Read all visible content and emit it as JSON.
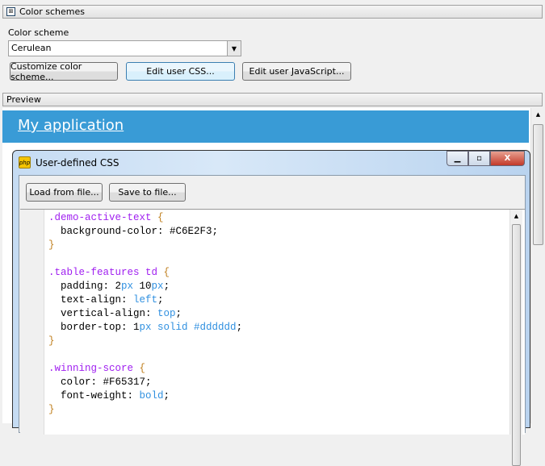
{
  "panel": {
    "title": "Color schemes",
    "scheme_label": "Color scheme",
    "scheme_value": "Cerulean",
    "buttons": {
      "customize": "Customize color scheme...",
      "edit_css": "Edit user CSS...",
      "edit_js": "Edit user JavaScript..."
    }
  },
  "preview": {
    "title": "Preview",
    "app_title": "My application"
  },
  "dialog": {
    "title": "User-defined CSS",
    "icon_text": "php",
    "close": "X",
    "load": "Load from file...",
    "save": "Save to file...",
    "code": [
      [
        [
          "sel",
          ".demo-active-text "
        ],
        [
          "br",
          "{"
        ]
      ],
      [
        [
          "plain",
          "  background-color: #C6E2F3;"
        ]
      ],
      [
        [
          "br",
          "}"
        ]
      ],
      [],
      [
        [
          "sel",
          ".table-features td "
        ],
        [
          "br",
          "{"
        ]
      ],
      [
        [
          "plain",
          "  padding: 2"
        ],
        [
          "val",
          "px "
        ],
        [
          "plain",
          "10"
        ],
        [
          "val",
          "px"
        ],
        [
          "plain",
          ";"
        ]
      ],
      [
        [
          "plain",
          "  text-align: "
        ],
        [
          "val",
          "left"
        ],
        [
          "plain",
          ";"
        ]
      ],
      [
        [
          "plain",
          "  vertical-align: "
        ],
        [
          "val",
          "top"
        ],
        [
          "plain",
          ";"
        ]
      ],
      [
        [
          "plain",
          "  border-top: 1"
        ],
        [
          "val",
          "px solid #dddddd"
        ],
        [
          "plain",
          ";"
        ]
      ],
      [
        [
          "br",
          "}"
        ]
      ],
      [],
      [
        [
          "sel",
          ".winning-score "
        ],
        [
          "br",
          "{"
        ]
      ],
      [
        [
          "plain",
          "  color: #F65317;"
        ]
      ],
      [
        [
          "plain",
          "  font-weight: "
        ],
        [
          "val",
          "bold"
        ],
        [
          "plain",
          ";"
        ]
      ],
      [
        [
          "br",
          "}"
        ]
      ]
    ]
  }
}
